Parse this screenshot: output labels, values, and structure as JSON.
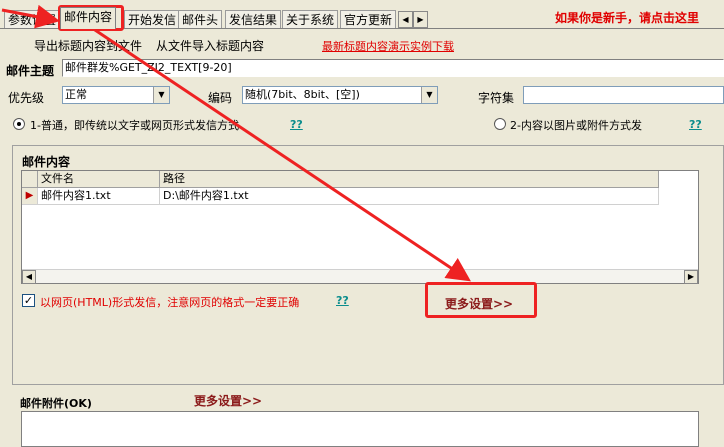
{
  "tabs": [
    {
      "label": "参数设置"
    },
    {
      "label": "邮件内容"
    },
    {
      "label": "开始发信"
    },
    {
      "label": "邮件头"
    },
    {
      "label": "发信结果"
    },
    {
      "label": "关于系统"
    },
    {
      "label": "官方更新"
    }
  ],
  "newbie_link": "如果你是新手，请点击这里",
  "actions": {
    "export_titles": "导出标题内容到文件",
    "import_titles": "从文件导入标题内容",
    "download_demo": "最新标题内容演示实例下载"
  },
  "subject": {
    "label": "邮件主题",
    "value": "邮件群发%GET_ZI2_TEXT[9-20]"
  },
  "priority": {
    "label": "优先级",
    "value": "正常"
  },
  "encoding": {
    "label": "编码",
    "value": "随机(7bit、8bit、[空])"
  },
  "charset": {
    "label": "字符集",
    "value": ""
  },
  "send_mode": {
    "option1": "1-普通，即传统以文字或网页形式发信方式",
    "option2": "2-内容以图片或附件方式发",
    "help": "??"
  },
  "content": {
    "group_label": "邮件内容",
    "columns": [
      "文件名",
      "路径"
    ],
    "rows": [
      {
        "filename": "邮件内容1.txt",
        "path": "D:\\邮件内容1.txt"
      }
    ]
  },
  "html_option": {
    "label": "以网页(HTML)形式发信，注意网页的格式一定要正确",
    "checked": true,
    "help": "??"
  },
  "more_settings": "更多设置>>",
  "attachments": {
    "label": "邮件附件(OK)",
    "more_settings": "更多设置>>"
  },
  "colors": {
    "accent_red": "#e00000",
    "highlight_box": "#ee2222",
    "help_link": "#0b8d8d",
    "more_button": "#8b1a1a"
  }
}
